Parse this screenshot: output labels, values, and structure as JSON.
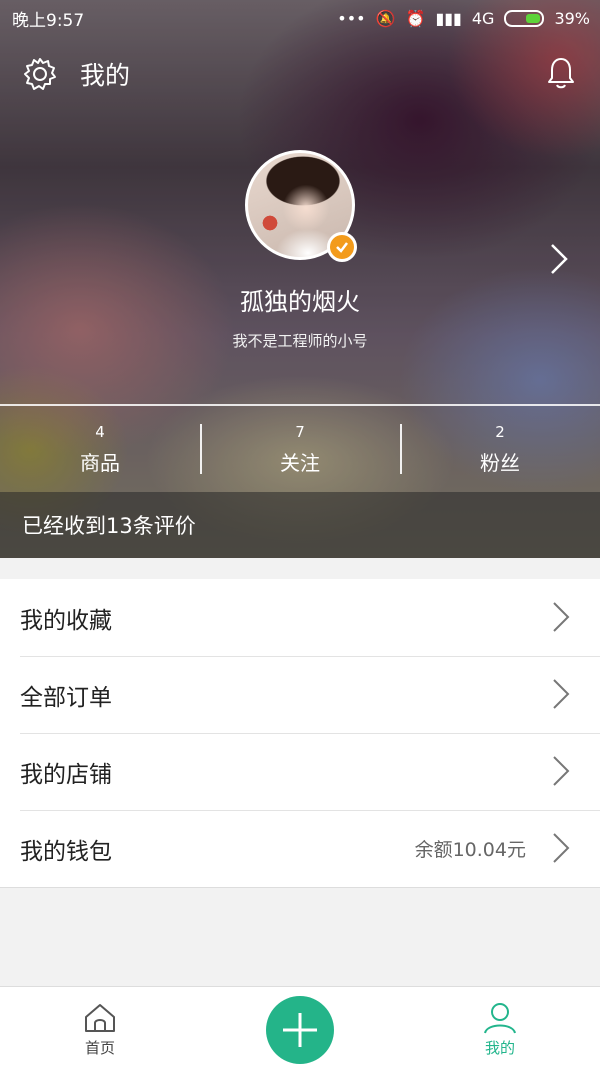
{
  "status_bar": {
    "time": "晚上9:57",
    "network": "4G",
    "battery": "39%"
  },
  "header": {
    "title": "我的"
  },
  "profile": {
    "nickname": "孤独的烟火",
    "signature": "我不是工程师的小号",
    "verified": true
  },
  "stats": [
    {
      "count": "4",
      "label": "商品"
    },
    {
      "count": "7",
      "label": "关注"
    },
    {
      "count": "2",
      "label": "粉丝"
    }
  ],
  "reviews_banner": "已经收到13条评价",
  "menu": [
    {
      "label": "我的收藏",
      "extra": ""
    },
    {
      "label": "全部订单",
      "extra": ""
    },
    {
      "label": "我的店铺",
      "extra": ""
    },
    {
      "label": "我的钱包",
      "extra": "余额10.04元"
    }
  ],
  "bottom_nav": {
    "home": "首页",
    "me": "我的"
  },
  "colors": {
    "accent": "#24b489",
    "verified_badge": "#f39b1b"
  }
}
